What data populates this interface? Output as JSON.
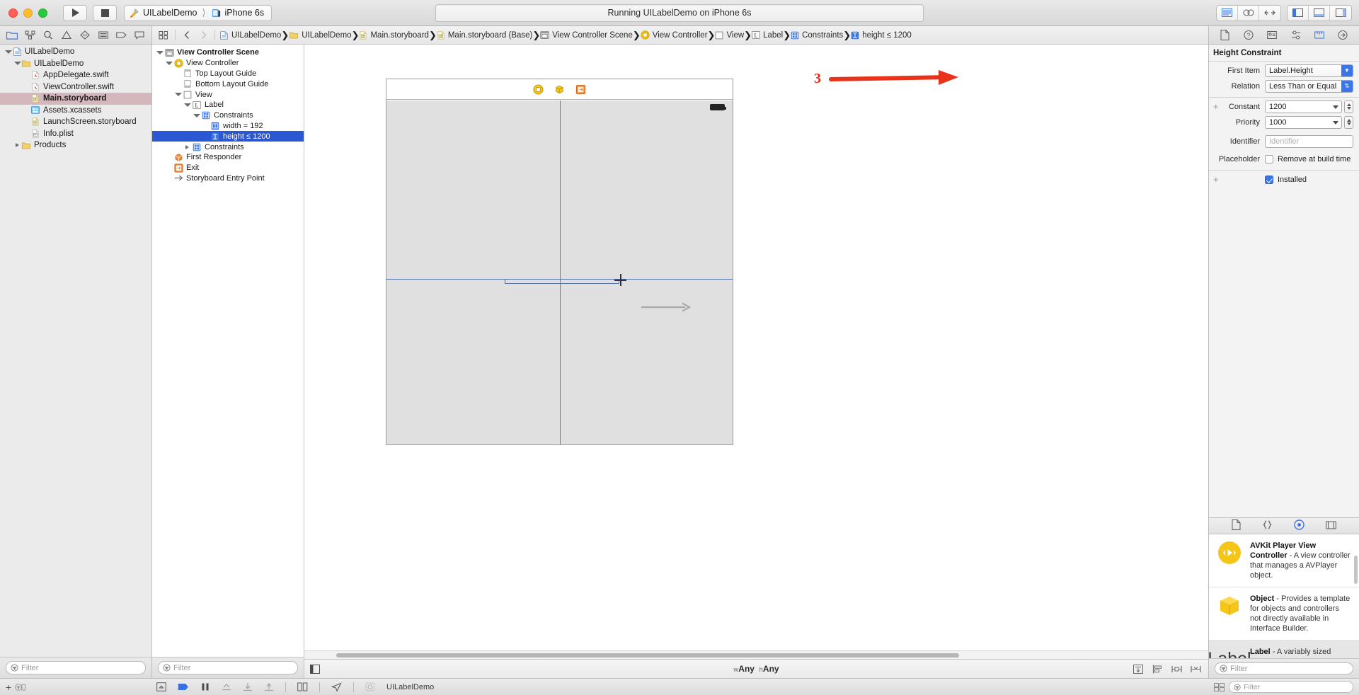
{
  "window": {
    "scheme_project": "UILabelDemo",
    "scheme_device": "iPhone 6s",
    "status_text": "Running UILabelDemo on iPhone 6s"
  },
  "navigator": {
    "filter_placeholder": "Filter",
    "tabs": [
      "folder-icon",
      "source-control-icon",
      "search-icon",
      "warning-icon",
      "test-icon",
      "debug-icon",
      "breakpoint-icon",
      "report-icon"
    ],
    "items": [
      {
        "label": "UILabelDemo",
        "indent": 0,
        "twisty": "open",
        "icon": "project-icon",
        "selected": false
      },
      {
        "label": "UILabelDemo",
        "indent": 1,
        "twisty": "open",
        "icon": "folder-icon",
        "selected": false
      },
      {
        "label": "AppDelegate.swift",
        "indent": 2,
        "twisty": "none",
        "icon": "swift-icon",
        "selected": false
      },
      {
        "label": "ViewController.swift",
        "indent": 2,
        "twisty": "none",
        "icon": "swift-icon",
        "selected": false
      },
      {
        "label": "Main.storyboard",
        "indent": 2,
        "twisty": "none",
        "icon": "storyboard-icon",
        "selected": true
      },
      {
        "label": "Assets.xcassets",
        "indent": 2,
        "twisty": "none",
        "icon": "assets-icon",
        "selected": false
      },
      {
        "label": "LaunchScreen.storyboard",
        "indent": 2,
        "twisty": "none",
        "icon": "storyboard-icon",
        "selected": false
      },
      {
        "label": "Info.plist",
        "indent": 2,
        "twisty": "none",
        "icon": "plist-icon",
        "selected": false
      },
      {
        "label": "Products",
        "indent": 1,
        "twisty": "closed",
        "icon": "folder-icon",
        "selected": false
      }
    ]
  },
  "jumpbar": {
    "crumbs": [
      {
        "label": "UILabelDemo",
        "icon": "project-icon"
      },
      {
        "label": "UILabelDemo",
        "icon": "folder-icon"
      },
      {
        "label": "Main.storyboard",
        "icon": "storyboard-icon"
      },
      {
        "label": "Main.storyboard (Base)",
        "icon": "storyboard-icon"
      },
      {
        "label": "View Controller Scene",
        "icon": "scene-icon"
      },
      {
        "label": "View Controller",
        "icon": "viewcontroller-icon"
      },
      {
        "label": "View",
        "icon": "view-icon"
      },
      {
        "label": "Label",
        "icon": "label-icon"
      },
      {
        "label": "Constraints",
        "icon": "constraints-icon"
      },
      {
        "label": "height ≤ 1200",
        "icon": "height-constraint-icon"
      }
    ]
  },
  "outline": {
    "filter_placeholder": "Filter",
    "items": [
      {
        "label": "View Controller Scene",
        "indent": 0,
        "twisty": "open",
        "icon": "scene-icon",
        "bold": true,
        "selected": false
      },
      {
        "label": "View Controller",
        "indent": 1,
        "twisty": "open",
        "icon": "viewcontroller-icon",
        "bold": false,
        "selected": false
      },
      {
        "label": "Top Layout Guide",
        "indent": 2,
        "twisty": "none",
        "icon": "top-guide-icon",
        "bold": false,
        "selected": false
      },
      {
        "label": "Bottom Layout Guide",
        "indent": 2,
        "twisty": "none",
        "icon": "bottom-guide-icon",
        "bold": false,
        "selected": false
      },
      {
        "label": "View",
        "indent": 2,
        "twisty": "open",
        "icon": "view-icon",
        "bold": false,
        "selected": false
      },
      {
        "label": "Label",
        "indent": 3,
        "twisty": "open",
        "icon": "label-icon",
        "bold": false,
        "selected": false
      },
      {
        "label": "Constraints",
        "indent": 4,
        "twisty": "open",
        "icon": "constraints-icon",
        "bold": false,
        "selected": false
      },
      {
        "label": "width = 192",
        "indent": 5,
        "twisty": "none",
        "icon": "width-constraint-icon",
        "bold": false,
        "selected": false
      },
      {
        "label": "height ≤ 1200",
        "indent": 5,
        "twisty": "none",
        "icon": "height-constraint-icon",
        "bold": false,
        "selected": true
      },
      {
        "label": "Constraints",
        "indent": 3,
        "twisty": "closed",
        "icon": "constraints-icon",
        "bold": false,
        "selected": false
      },
      {
        "label": "First Responder",
        "indent": 1,
        "twisty": "none",
        "icon": "first-responder-icon",
        "bold": false,
        "selected": false
      },
      {
        "label": "Exit",
        "indent": 1,
        "twisty": "none",
        "icon": "exit-icon",
        "bold": false,
        "selected": false
      },
      {
        "label": "Storyboard Entry Point",
        "indent": 1,
        "twisty": "none",
        "icon": "entry-point-icon",
        "bold": false,
        "selected": false
      }
    ]
  },
  "canvas": {
    "size_class_w_prefix": "w",
    "size_class_w": "Any",
    "size_class_h_prefix": "h",
    "size_class_h": "Any"
  },
  "inspector": {
    "title": "Height Constraint",
    "first_item_label": "First Item",
    "first_item_value": "Label.Height",
    "relation_label": "Relation",
    "relation_value": "Less Than or Equal",
    "constant_label": "Constant",
    "constant_value": "1200",
    "priority_label": "Priority",
    "priority_value": "1000",
    "identifier_label": "Identifier",
    "identifier_placeholder": "Identifier",
    "placeholder_label": "Placeholder",
    "placeholder_checkbox_label": "Remove at build time",
    "placeholder_checked": false,
    "installed_label": "Installed",
    "installed_checked": true
  },
  "library": {
    "filter_placeholder": "Filter",
    "items": [
      {
        "icon": "avkit-player-icon",
        "title": "AVKit Player View Controller",
        "desc": " - A view controller that manages a AVPlayer object.",
        "selected": false
      },
      {
        "icon": "object-cube-icon",
        "title": "Object",
        "desc": " - Provides a template for objects and controllers not directly available in Interface Builder.",
        "selected": false
      },
      {
        "icon": "label-text-icon",
        "title": "Label",
        "desc": " - A variably sized amount of static text.",
        "selected": true
      }
    ],
    "label_icon_text": "Label"
  },
  "bottom_toolbar": {
    "scheme_name": "UILabelDemo"
  },
  "annotations": [
    {
      "number": "3",
      "color": "#e02b12"
    }
  ]
}
